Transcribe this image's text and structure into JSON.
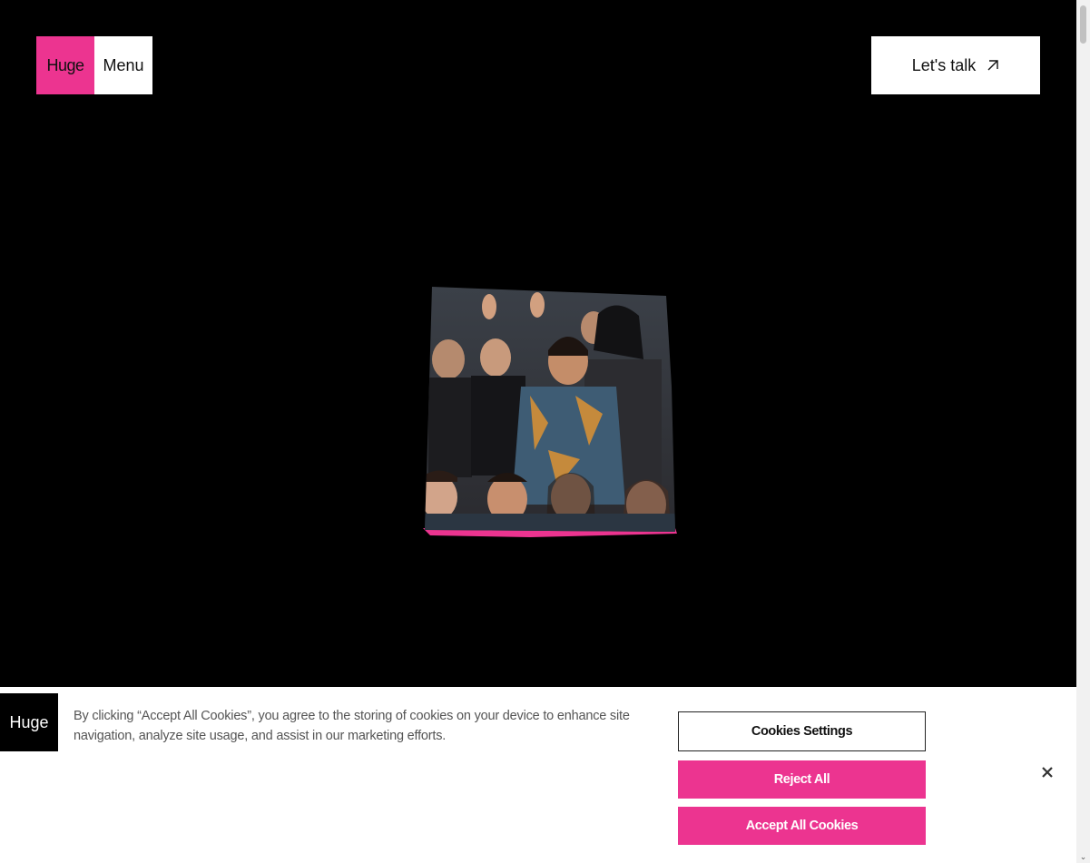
{
  "header": {
    "logo_text": "Huge",
    "menu_label": "Menu",
    "cta_label": "Let's talk",
    "cta_icon": "arrow-up-right-icon"
  },
  "hero": {
    "image": "group-photo"
  },
  "cookie_banner": {
    "logo_text": "Huge",
    "message": "By clicking “Accept All Cookies”, you agree to the storing of cookies on your device to enhance site navigation, analyze site usage, and assist in our marketing efforts.",
    "settings_label": "Cookies Settings",
    "reject_label": "Reject All",
    "accept_label": "Accept All Cookies",
    "close_icon": "close-icon"
  },
  "colors": {
    "brand_pink": "#ec3490",
    "background": "#000000",
    "surface": "#ffffff"
  }
}
